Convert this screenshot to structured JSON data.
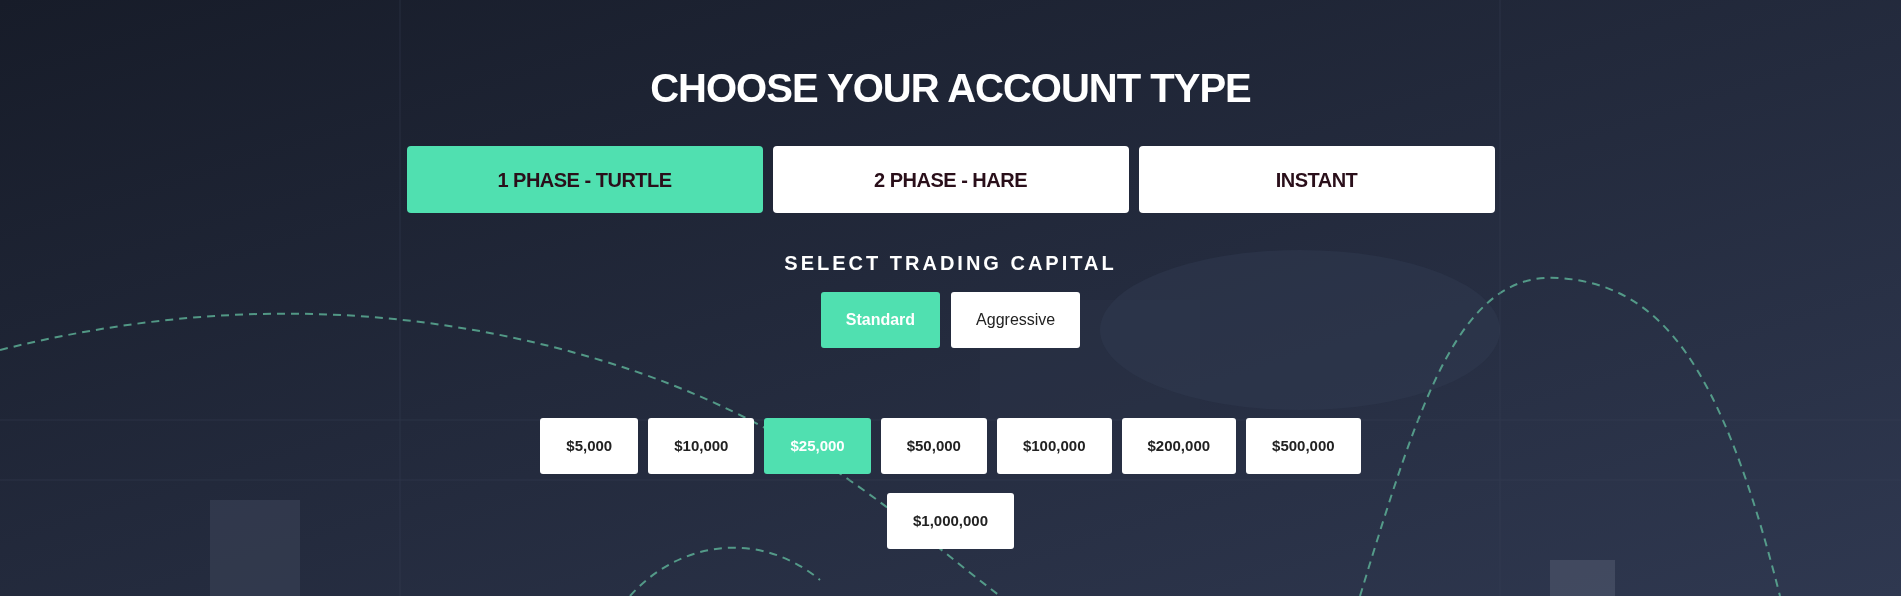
{
  "title": "CHOOSE YOUR ACCOUNT TYPE",
  "account_types": [
    {
      "label": "1 PHASE - TURTLE",
      "selected": true
    },
    {
      "label": "2 PHASE - HARE",
      "selected": false
    },
    {
      "label": "INSTANT",
      "selected": false
    }
  ],
  "capital_heading": "SELECT TRADING CAPITAL",
  "modes": [
    {
      "label": "Standard",
      "selected": true
    },
    {
      "label": "Aggressive",
      "selected": false
    }
  ],
  "amounts": [
    {
      "label": "$5,000",
      "selected": false
    },
    {
      "label": "$10,000",
      "selected": false
    },
    {
      "label": "$25,000",
      "selected": true
    },
    {
      "label": "$50,000",
      "selected": false
    },
    {
      "label": "$100,000",
      "selected": false
    },
    {
      "label": "$200,000",
      "selected": false
    },
    {
      "label": "$500,000",
      "selected": false
    },
    {
      "label": "$1,000,000",
      "selected": false
    }
  ]
}
